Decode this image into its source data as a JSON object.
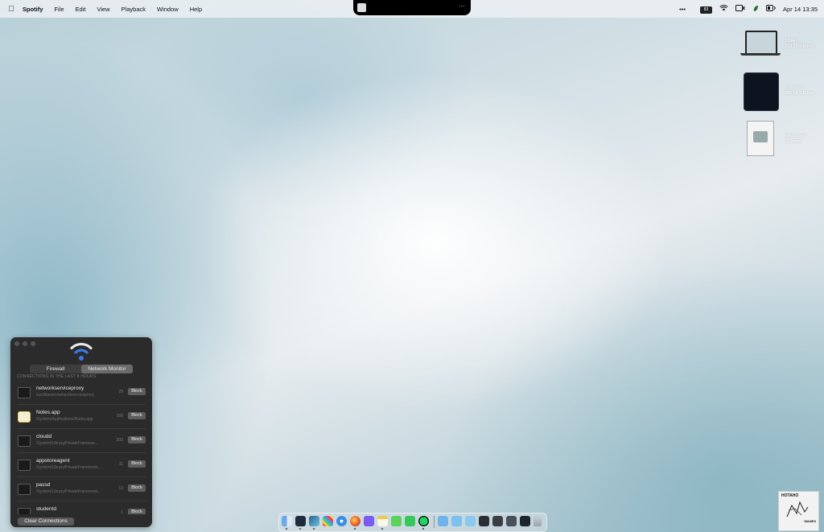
{
  "menubar": {
    "app_name": "Spotify",
    "menus": [
      "File",
      "Edit",
      "View",
      "Playback",
      "Window",
      "Help"
    ],
    "battery_label": "83",
    "date_time": "Apr 14  13:35",
    "notch_more": "···",
    "more_dots": "•••"
  },
  "desktop_icons": [
    {
      "name": "SSAFO",
      "info": "293,15 GB free"
    },
    {
      "name": "EVO 870",
      "info": "380,84 GB free"
    },
    {
      "name": "NetShared",
      "info": "29 items"
    }
  ],
  "panel": {
    "tabs": [
      {
        "label": "Firewall",
        "active": false
      },
      {
        "label": "Network Monitor",
        "active": true
      }
    ],
    "section_label": "CONNECTIONS IN THE LAST 8 HOURS",
    "block_label": "Block",
    "connections": [
      {
        "name": "networkserviceproxy",
        "path": "/usr/libexec/networkserviceproxy",
        "count": "29",
        "icon": "terminal-icon"
      },
      {
        "name": "Notes.app",
        "path": "/System/Applications/Notes.app",
        "count": "168",
        "icon": "notes-icon"
      },
      {
        "name": "cloudd",
        "path": "/System/Library/PrivateFramewo...",
        "count": "202",
        "icon": "terminal-icon"
      },
      {
        "name": "appstoreagent",
        "path": "/System/Library/PrivateFramework...",
        "count": "11",
        "icon": "terminal-icon"
      },
      {
        "name": "passd",
        "path": "/System/Library/PrivateFramework...",
        "count": "13",
        "icon": "terminal-icon"
      },
      {
        "name": "studentd",
        "path": "",
        "count": "1",
        "icon": "terminal-icon"
      }
    ],
    "clear_label": "Clear Connections"
  },
  "thumbnail": {
    "top_text": "HOTAHO",
    "bottom_text": "MANES"
  },
  "colors": {
    "panel_bg": "#2b2b2b",
    "wifi_blue": "#3a78e6",
    "active_tab": "#6a6a6a"
  }
}
